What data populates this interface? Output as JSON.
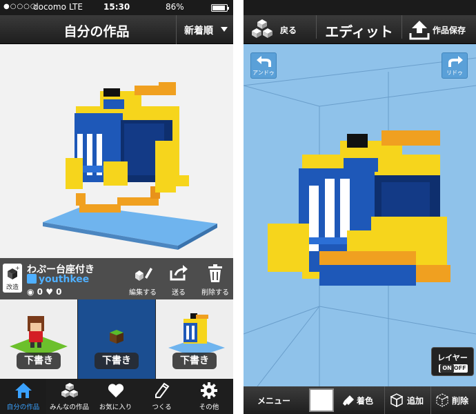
{
  "status": {
    "carrier": "docomo",
    "network": "LTE",
    "time": "15:30",
    "battery": "86%"
  },
  "left_nav": {
    "title": "自分の作品",
    "sort_label": "新着順"
  },
  "work": {
    "title": "わぷー台座付き",
    "author": "youthkee",
    "views": "0",
    "likes": "0",
    "modify_label": "改造"
  },
  "actions": [
    {
      "label": "編集する",
      "icon": "pencil-icon"
    },
    {
      "label": "送る",
      "icon": "share-icon"
    },
    {
      "label": "削除する",
      "icon": "trash-icon"
    }
  ],
  "drafts": [
    {
      "label": "下書き"
    },
    {
      "label": "下書き"
    },
    {
      "label": "下書き"
    }
  ],
  "tabs": [
    {
      "label": "自分の作品",
      "icon": "home-icon",
      "active": true
    },
    {
      "label": "みんなの作品",
      "icon": "cubes-icon"
    },
    {
      "label": "お気に入り",
      "icon": "heart-icon"
    },
    {
      "label": "つくる",
      "icon": "pencil-icon"
    },
    {
      "label": "その他",
      "icon": "gear-icon"
    }
  ],
  "editor": {
    "back_label": "戻る",
    "title": "エディット",
    "save_label": "作品保存",
    "undo_label": "アンドゥ",
    "redo_label": "リドゥ",
    "layer_label": "レイヤー",
    "layer_on": "ON",
    "layer_off": "OFF",
    "menu_label": "メニュー",
    "color_label": "着色",
    "add_label": "追加",
    "delete_label": "削除"
  },
  "colors": {
    "accent_blue": "#3aa2ff",
    "canvas_bg": "#8fc2ea",
    "draft_active_bg": "#1b4e91"
  }
}
